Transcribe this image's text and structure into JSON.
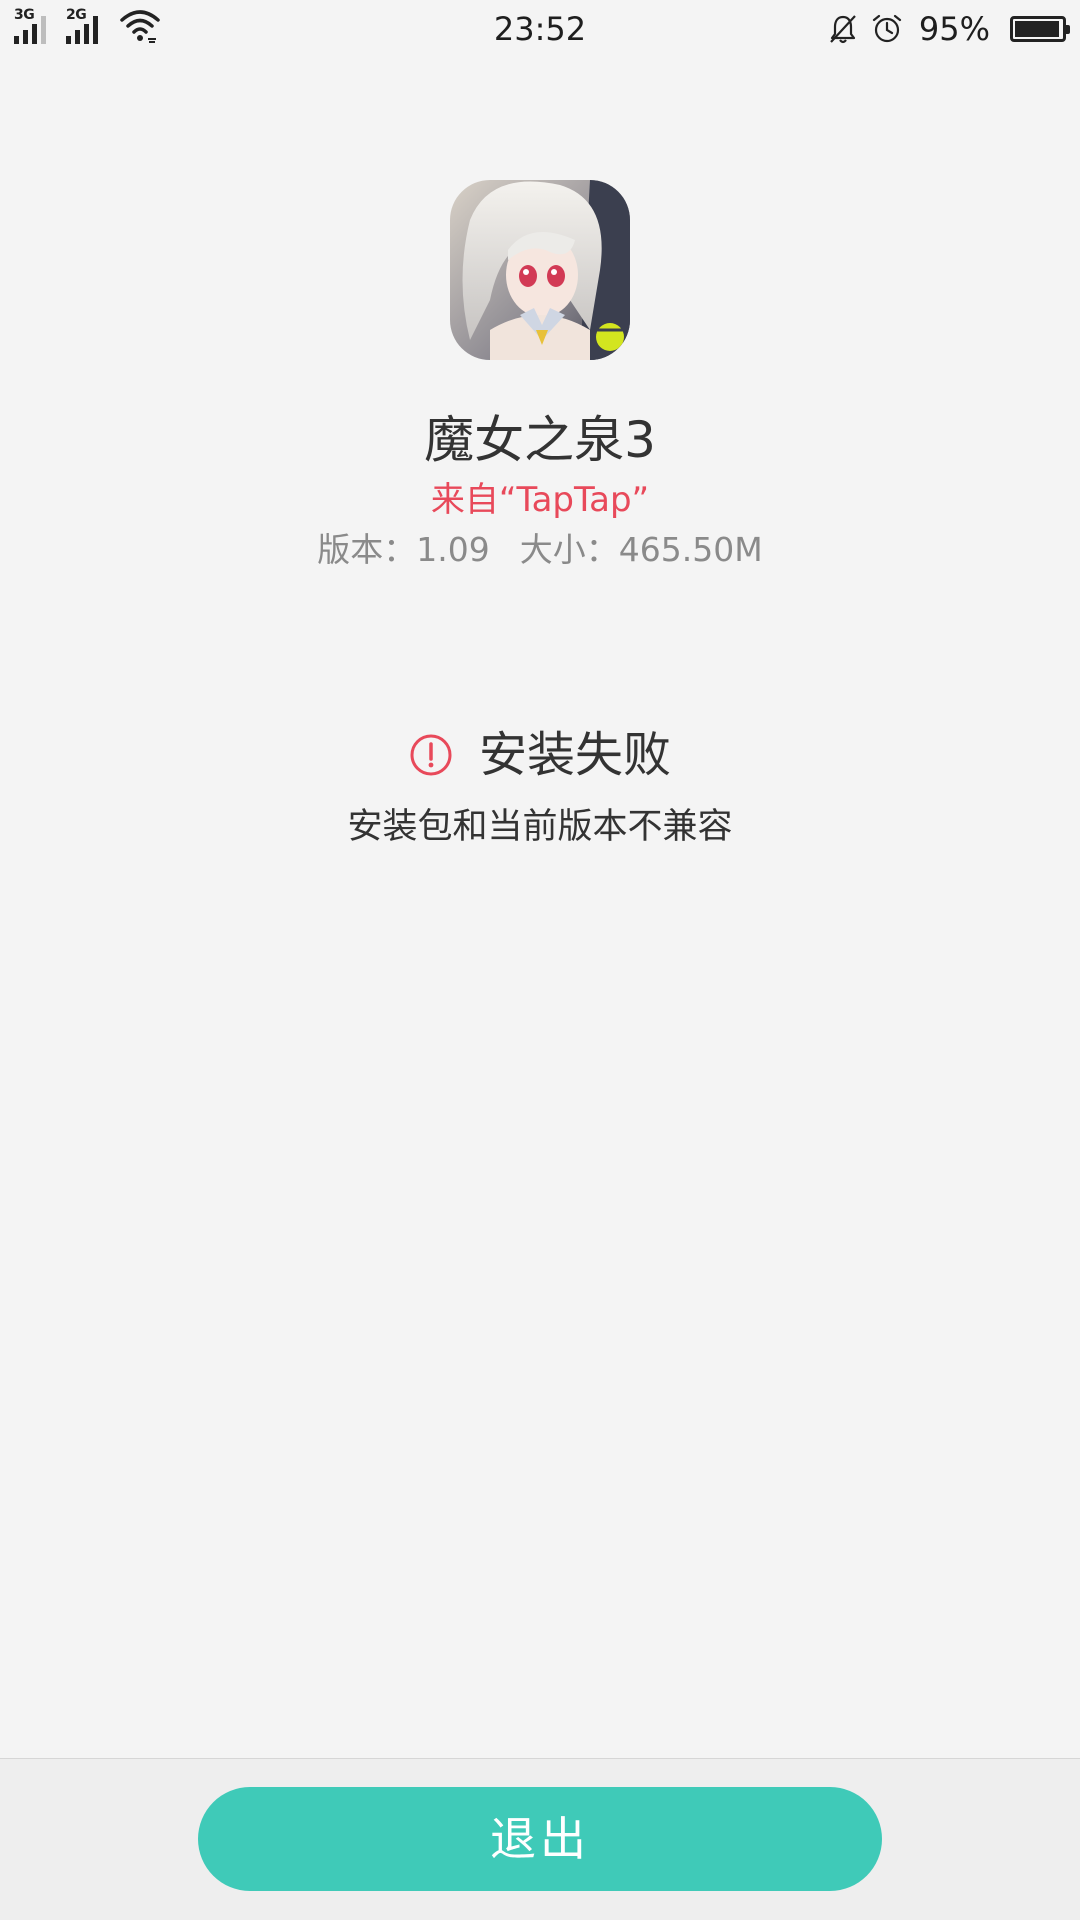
{
  "status_bar": {
    "network_1": "3G",
    "network_2": "2G",
    "time": "23:52",
    "battery_percent": "95%",
    "battery_level": 0.95,
    "icons": [
      "signal-3g-icon",
      "signal-2g-icon",
      "wifi-icon",
      "mute-bell-icon",
      "alarm-icon",
      "battery-icon"
    ]
  },
  "app": {
    "icon": "app-icon-anime-girl",
    "name": "魔女之泉3",
    "source": "来自“TapTap”",
    "version": "版本：1.09",
    "size": "大小：465.50M"
  },
  "result": {
    "icon": "warning-circle-icon",
    "title": "安装失败",
    "message": "安装包和当前版本不兼容",
    "accent_color": "#e8495a"
  },
  "actions": {
    "exit_label": "退出",
    "exit_color": "#3fcab8"
  }
}
